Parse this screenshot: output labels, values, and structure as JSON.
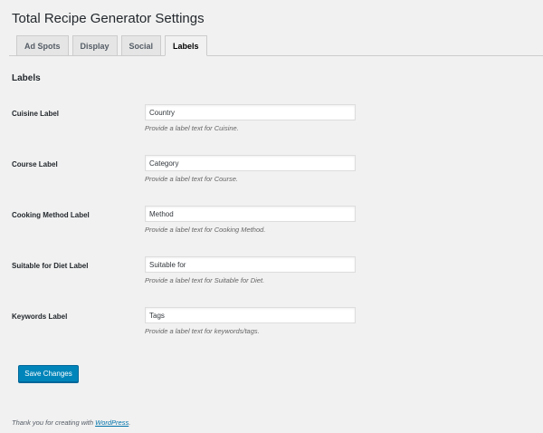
{
  "page": {
    "title": "Total Recipe Generator Settings"
  },
  "tabs": [
    {
      "label": "Ad Spots",
      "active": false
    },
    {
      "label": "Display",
      "active": false
    },
    {
      "label": "Social",
      "active": false
    },
    {
      "label": "Labels",
      "active": true
    }
  ],
  "section": {
    "heading": "Labels"
  },
  "fields": [
    {
      "label": "Cuisine Label",
      "value": "Country",
      "description": "Provide a label text for Cuisine."
    },
    {
      "label": "Course Label",
      "value": "Category",
      "description": "Provide a label text for Course."
    },
    {
      "label": "Cooking Method Label",
      "value": "Method",
      "description": "Provide a label text for Cooking Method."
    },
    {
      "label": "Suitable for Diet Label",
      "value": "Suitable for",
      "description": "Provide a label text for Suitable for Diet."
    },
    {
      "label": "Keywords Label",
      "value": "Tags",
      "description": "Provide a label text for keywords/tags."
    }
  ],
  "actions": {
    "save_label": "Save Changes"
  },
  "footer": {
    "text_before": "Thank you for creating with ",
    "link_text": "WordPress",
    "text_after": "."
  },
  "colors": {
    "background": "#f1f1f1",
    "primary_button": "#0085ba",
    "link": "#0073aa"
  }
}
